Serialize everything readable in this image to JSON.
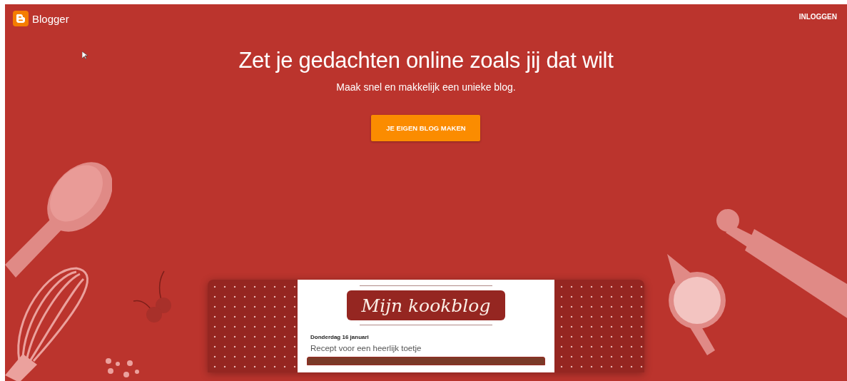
{
  "header": {
    "logo_text": "Blogger",
    "login_link": "INLOGGEN"
  },
  "hero": {
    "title": "Zet je gedachten online zoals jij dat wilt",
    "subtitle": "Maak snel en makkelijk een unieke blog.",
    "cta_button": "JE EIGEN BLOG MAKEN"
  },
  "blog_preview": {
    "blog_title": "Mijn kookblog",
    "post_date": "Donderdag 16 januari",
    "post_title": "Recept voor een heerlijk toetje"
  }
}
